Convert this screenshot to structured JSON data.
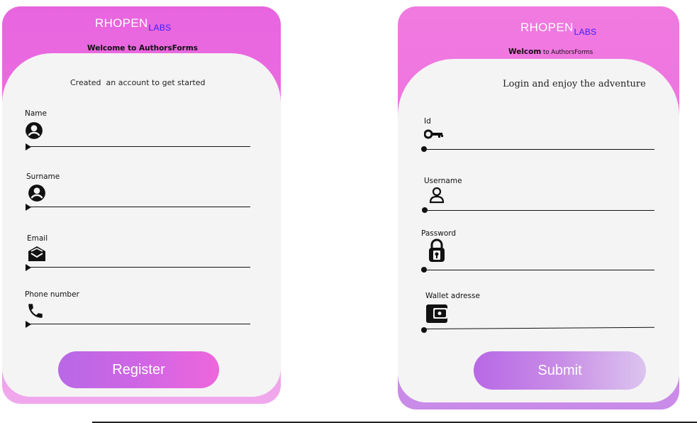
{
  "register_form": {
    "brand": "RHOPEN",
    "brand_sub": "LABS",
    "welcome": "Welcome to AuthorsForms",
    "subtitle": "Created  an account to get started",
    "fields": [
      {
        "label": "Name",
        "icon": "account-circle-icon"
      },
      {
        "label": "Surname",
        "icon": "account-circle-icon"
      },
      {
        "label": "Email",
        "icon": "mail-open-icon"
      },
      {
        "label": "Phone number",
        "icon": "phone-icon"
      }
    ],
    "button_label": "Register",
    "colors": {
      "header": "#e865df",
      "button": "#cf66e4"
    }
  },
  "login_form": {
    "brand": "RHOPEN",
    "brand_sub": "LABS",
    "welcome_bold": "Welcom",
    "welcome_rest": "to AuthorsForms",
    "subtitle": "Login and enjoy the adventure",
    "fields": [
      {
        "label": "Id",
        "icon": "key-icon"
      },
      {
        "label": "Username",
        "icon": "user-outline-icon"
      },
      {
        "label": "Password",
        "icon": "lock-icon"
      },
      {
        "label": "Wallet adresse",
        "icon": "wallet-icon"
      }
    ],
    "button_label": "Submit",
    "colors": {
      "header": "#f07ae0",
      "button": "#c88de6"
    }
  }
}
